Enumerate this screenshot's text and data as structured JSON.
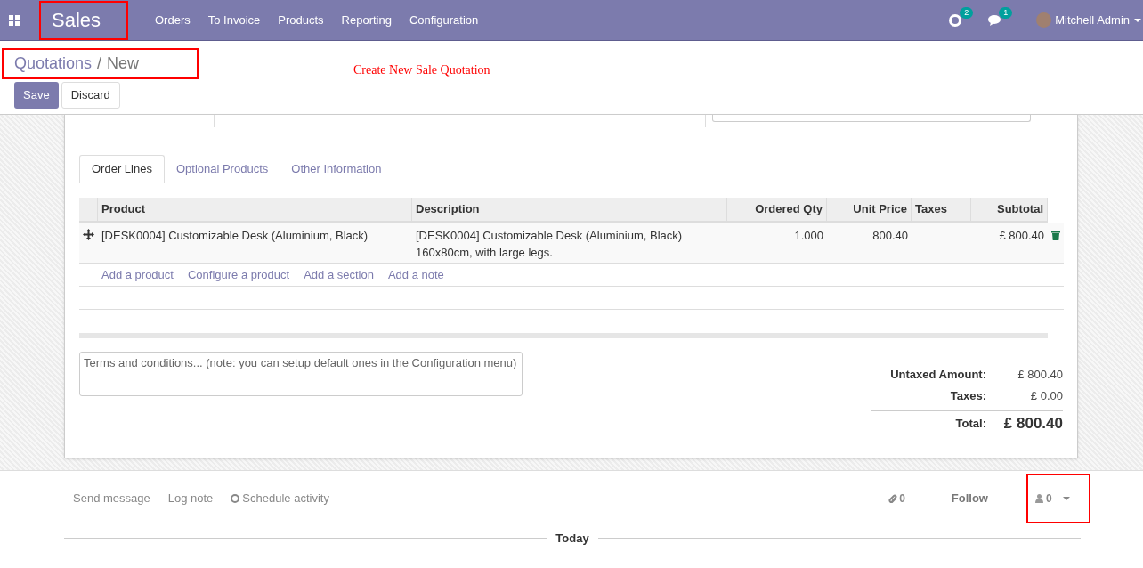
{
  "navbar": {
    "app": {
      "label": "Sales",
      "highlighted": true
    },
    "menu": [
      "Orders",
      "To Invoice",
      "Products",
      "Reporting",
      "Configuration"
    ],
    "activity_count": "2",
    "message_count": "1",
    "user": "Mitchell Admin"
  },
  "breadcrumb": {
    "parent": "Quotations",
    "separator": "/",
    "current": "New",
    "highlighted": true
  },
  "annotation": "Create New Sale Quotation",
  "buttons": [
    {
      "label": "Save",
      "kind": "primary"
    },
    {
      "label": "Discard",
      "kind": "secondary"
    }
  ],
  "tabs": [
    {
      "label": "Order Lines",
      "selected": true
    },
    {
      "label": "Optional Products",
      "selected": false
    },
    {
      "label": "Other Information",
      "selected": false
    }
  ],
  "table": {
    "columns": [
      "Product",
      "Description",
      "Ordered Qty",
      "Unit Price",
      "Taxes",
      "Subtotal"
    ],
    "rows": [
      [
        "[DESK0004] Customizable Desk (Aluminium, Black)",
        "[DESK0004] Customizable Desk (Aluminium, Black)\n160x80cm, with large legs.",
        "1.000",
        "800.40",
        "",
        "£ 800.40"
      ]
    ],
    "add_links": [
      "Add a product",
      "Configure a product",
      "Add a section",
      "Add a note"
    ]
  },
  "terms": {
    "placeholder": "Terms and conditions... (note: you can setup default ones in the Configuration menu)"
  },
  "totals": [
    {
      "label": "Untaxed Amount:",
      "value": "£ 800.40",
      "kind": "line"
    },
    {
      "label": "Taxes:",
      "value": "£ 0.00",
      "kind": "line"
    },
    {
      "label": "Total:",
      "value": "£ 800.40",
      "kind": "total"
    }
  ],
  "chatter": {
    "actions": [
      "Send message",
      "Log note",
      "Schedule activity"
    ],
    "attachments": "0",
    "follow": "Follow",
    "followers": {
      "count": "0",
      "highlighted": true
    },
    "separator": "Today"
  }
}
